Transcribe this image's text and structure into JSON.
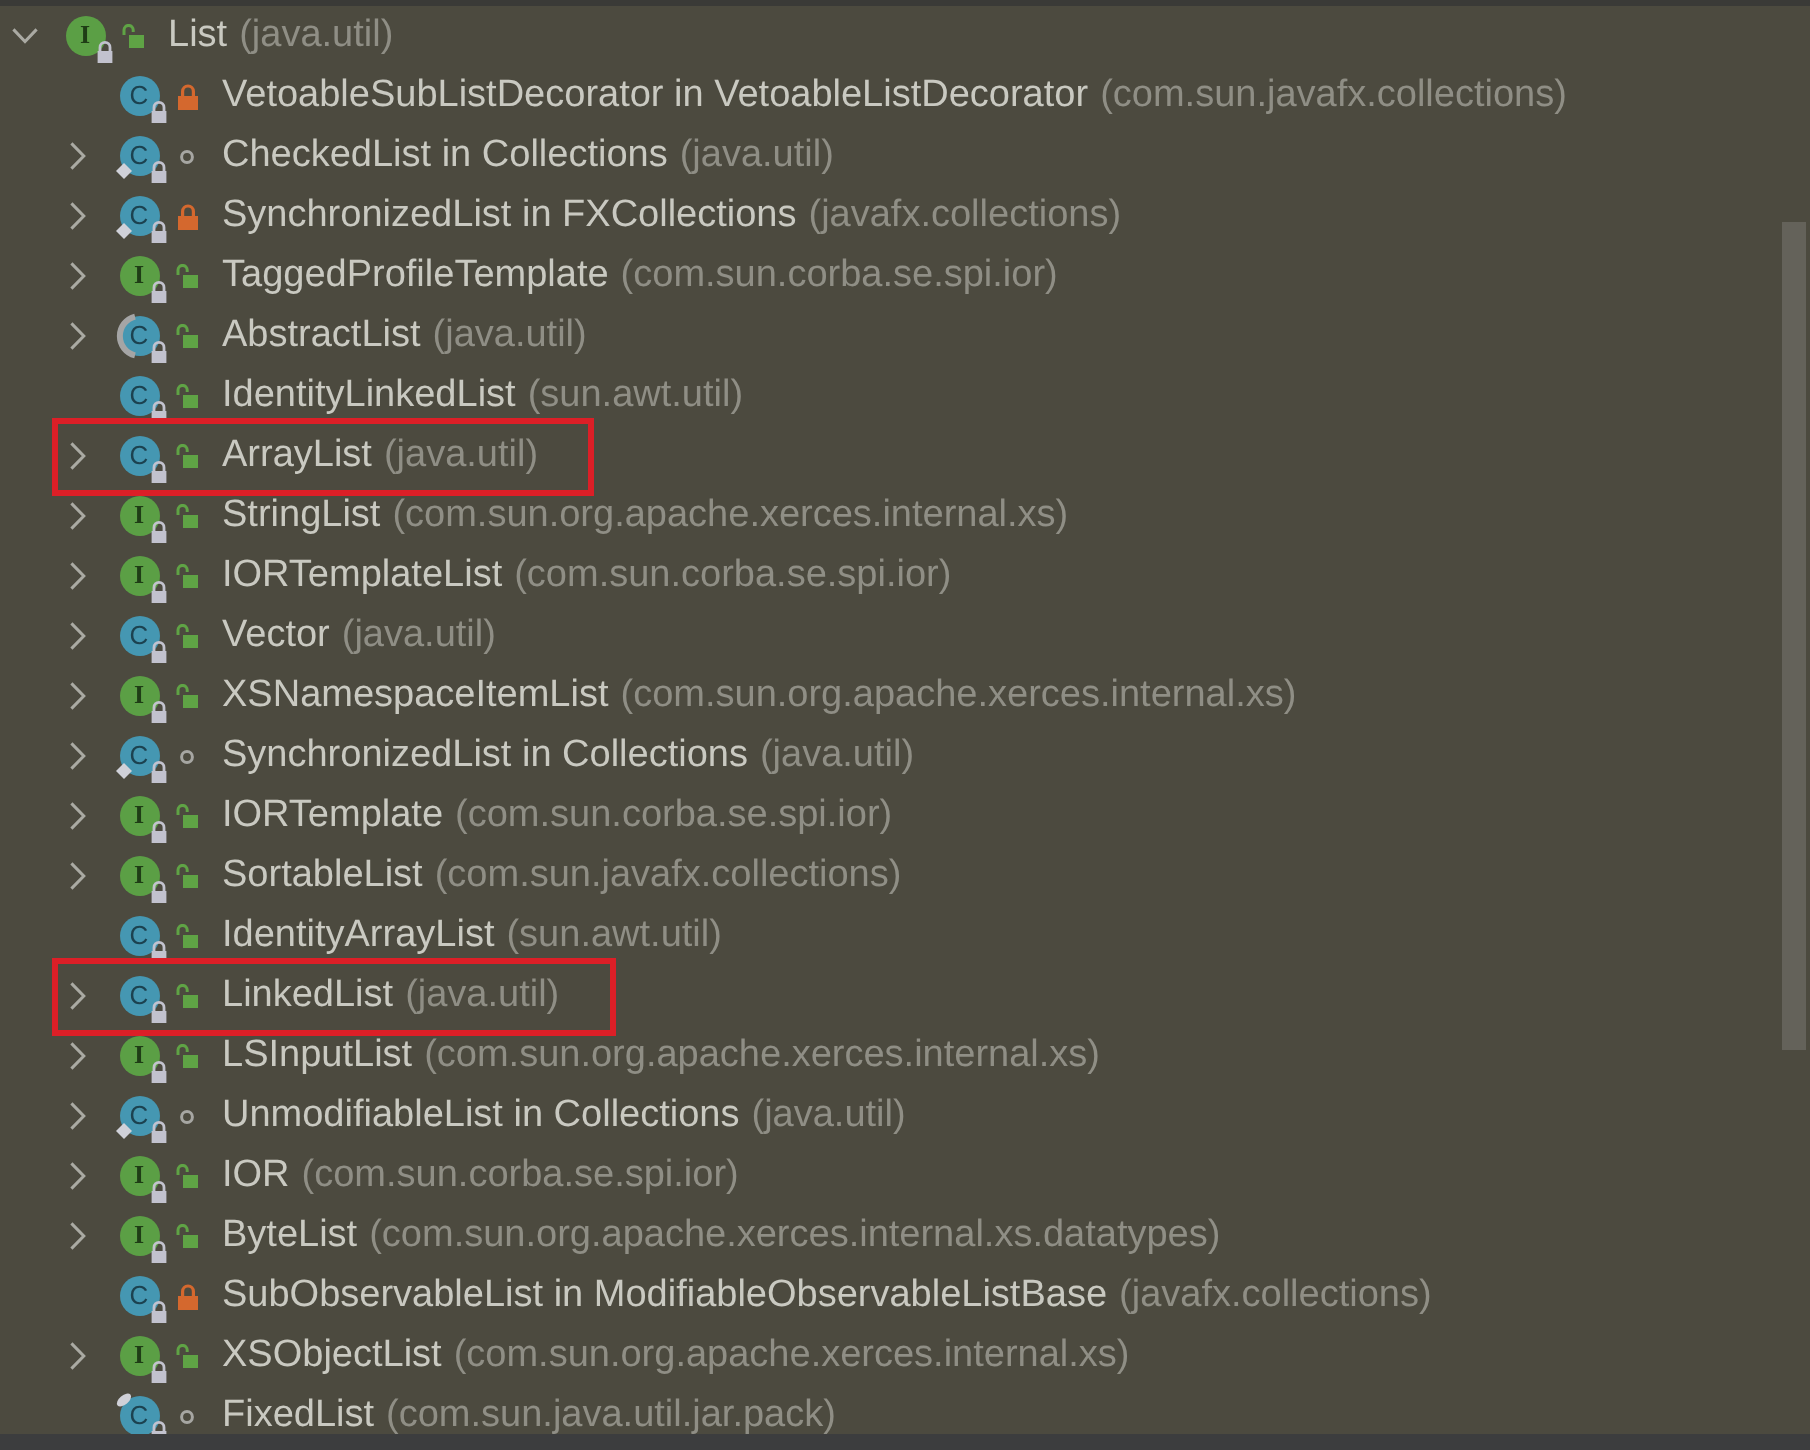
{
  "tree": [
    {
      "kind": "interface",
      "type_letter": "I",
      "static": false,
      "top_mark": false,
      "private": false,
      "package_private": false,
      "name": "List",
      "package": "(java.util)",
      "expandable": true,
      "expanded": true,
      "highlighted": false,
      "children": [
        {
          "kind": "class",
          "type_letter": "C",
          "static": false,
          "top_mark": false,
          "private": true,
          "package_private": false,
          "name": "VetoableSubListDecorator in VetoableListDecorator",
          "package": "(com.sun.javafx.collections)",
          "expandable": false,
          "highlighted": false
        },
        {
          "kind": "class",
          "type_letter": "C",
          "static": true,
          "top_mark": false,
          "private": false,
          "package_private": true,
          "name": "CheckedList in Collections",
          "package": "(java.util)",
          "expandable": true,
          "highlighted": false
        },
        {
          "kind": "class",
          "type_letter": "C",
          "static": true,
          "top_mark": false,
          "private": true,
          "package_private": false,
          "name": "SynchronizedList in FXCollections",
          "package": "(javafx.collections)",
          "expandable": true,
          "highlighted": false
        },
        {
          "kind": "interface",
          "type_letter": "I",
          "static": false,
          "top_mark": false,
          "private": false,
          "package_private": false,
          "name": "TaggedProfileTemplate",
          "package": "(com.sun.corba.se.spi.ior)",
          "expandable": true,
          "highlighted": false
        },
        {
          "kind": "abstract_class",
          "type_letter": "C",
          "static": false,
          "top_mark": false,
          "private": false,
          "package_private": false,
          "name": "AbstractList",
          "package": "(java.util)",
          "expandable": true,
          "highlighted": false
        },
        {
          "kind": "class",
          "type_letter": "C",
          "static": false,
          "top_mark": false,
          "private": false,
          "package_private": false,
          "name": "IdentityLinkedList",
          "package": "(sun.awt.util)",
          "expandable": false,
          "highlighted": false
        },
        {
          "kind": "class",
          "type_letter": "C",
          "static": false,
          "top_mark": false,
          "private": false,
          "package_private": false,
          "name": "ArrayList",
          "package": "(java.util)",
          "expandable": true,
          "highlighted": true
        },
        {
          "kind": "interface",
          "type_letter": "I",
          "static": false,
          "top_mark": false,
          "private": false,
          "package_private": false,
          "name": "StringList",
          "package": "(com.sun.org.apache.xerces.internal.xs)",
          "expandable": true,
          "highlighted": false
        },
        {
          "kind": "interface",
          "type_letter": "I",
          "static": false,
          "top_mark": false,
          "private": false,
          "package_private": false,
          "name": "IORTemplateList",
          "package": "(com.sun.corba.se.spi.ior)",
          "expandable": true,
          "highlighted": false
        },
        {
          "kind": "class",
          "type_letter": "C",
          "static": false,
          "top_mark": false,
          "private": false,
          "package_private": false,
          "name": "Vector",
          "package": "(java.util)",
          "expandable": true,
          "highlighted": false
        },
        {
          "kind": "interface",
          "type_letter": "I",
          "static": false,
          "top_mark": false,
          "private": false,
          "package_private": false,
          "name": "XSNamespaceItemList",
          "package": "(com.sun.org.apache.xerces.internal.xs)",
          "expandable": true,
          "highlighted": false
        },
        {
          "kind": "class",
          "type_letter": "C",
          "static": true,
          "top_mark": false,
          "private": false,
          "package_private": true,
          "name": "SynchronizedList in Collections",
          "package": "(java.util)",
          "expandable": true,
          "highlighted": false
        },
        {
          "kind": "interface",
          "type_letter": "I",
          "static": false,
          "top_mark": false,
          "private": false,
          "package_private": false,
          "name": "IORTemplate",
          "package": "(com.sun.corba.se.spi.ior)",
          "expandable": true,
          "highlighted": false
        },
        {
          "kind": "interface",
          "type_letter": "I",
          "static": false,
          "top_mark": false,
          "private": false,
          "package_private": false,
          "name": "SortableList",
          "package": "(com.sun.javafx.collections)",
          "expandable": true,
          "highlighted": false
        },
        {
          "kind": "class",
          "type_letter": "C",
          "static": false,
          "top_mark": false,
          "private": false,
          "package_private": false,
          "name": "IdentityArrayList",
          "package": "(sun.awt.util)",
          "expandable": false,
          "highlighted": false
        },
        {
          "kind": "class",
          "type_letter": "C",
          "static": false,
          "top_mark": false,
          "private": false,
          "package_private": false,
          "name": "LinkedList",
          "package": "(java.util)",
          "expandable": true,
          "highlighted": true
        },
        {
          "kind": "interface",
          "type_letter": "I",
          "static": false,
          "top_mark": false,
          "private": false,
          "package_private": false,
          "name": "LSInputList",
          "package": "(com.sun.org.apache.xerces.internal.xs)",
          "expandable": true,
          "highlighted": false
        },
        {
          "kind": "class",
          "type_letter": "C",
          "static": true,
          "top_mark": false,
          "private": false,
          "package_private": true,
          "name": "UnmodifiableList in Collections",
          "package": "(java.util)",
          "expandable": true,
          "highlighted": false
        },
        {
          "kind": "interface",
          "type_letter": "I",
          "static": false,
          "top_mark": false,
          "private": false,
          "package_private": false,
          "name": "IOR",
          "package": "(com.sun.corba.se.spi.ior)",
          "expandable": true,
          "highlighted": false
        },
        {
          "kind": "interface",
          "type_letter": "I",
          "static": false,
          "top_mark": false,
          "private": false,
          "package_private": false,
          "name": "ByteList",
          "package": "(com.sun.org.apache.xerces.internal.xs.datatypes)",
          "expandable": true,
          "highlighted": false
        },
        {
          "kind": "class",
          "type_letter": "C",
          "static": false,
          "top_mark": false,
          "private": true,
          "package_private": false,
          "name": "SubObservableList in ModifiableObservableListBase",
          "package": "(javafx.collections)",
          "expandable": false,
          "highlighted": false
        },
        {
          "kind": "interface",
          "type_letter": "I",
          "static": false,
          "top_mark": false,
          "private": false,
          "package_private": false,
          "name": "XSObjectList",
          "package": "(com.sun.org.apache.xerces.internal.xs)",
          "expandable": true,
          "highlighted": false
        },
        {
          "kind": "class",
          "type_letter": "C",
          "static": false,
          "top_mark": true,
          "private": false,
          "package_private": true,
          "name": "FixedList",
          "package": "(com.sun.java.util.jar.pack)",
          "expandable": false,
          "highlighted": false
        }
      ]
    }
  ]
}
